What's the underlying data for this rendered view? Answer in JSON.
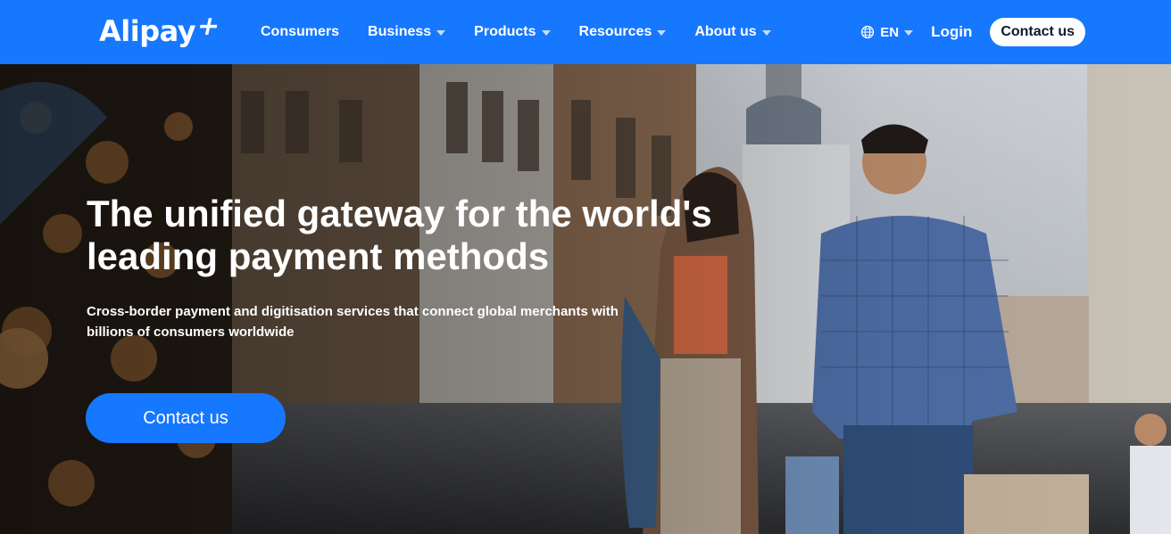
{
  "header": {
    "logo_text": "Alipay",
    "logo_mark": "+",
    "nav": [
      {
        "label": "Consumers",
        "has_dropdown": false
      },
      {
        "label": "Business",
        "has_dropdown": true
      },
      {
        "label": "Products",
        "has_dropdown": true
      },
      {
        "label": "Resources",
        "has_dropdown": true
      },
      {
        "label": "About us",
        "has_dropdown": true
      }
    ],
    "language": {
      "label": "EN",
      "icon": "globe-icon"
    },
    "login_label": "Login",
    "contact_label": "Contact us"
  },
  "hero": {
    "title_line1": "The unified gateway for the world's",
    "title_line2": "leading payment methods",
    "subtitle_line1": "Cross-border payment and digitisation services that connect global merchants with",
    "subtitle_line2": "billions of consumers worldwide",
    "cta_label": "Contact us"
  },
  "colors": {
    "brand_blue": "#1677ff",
    "white": "#ffffff"
  }
}
